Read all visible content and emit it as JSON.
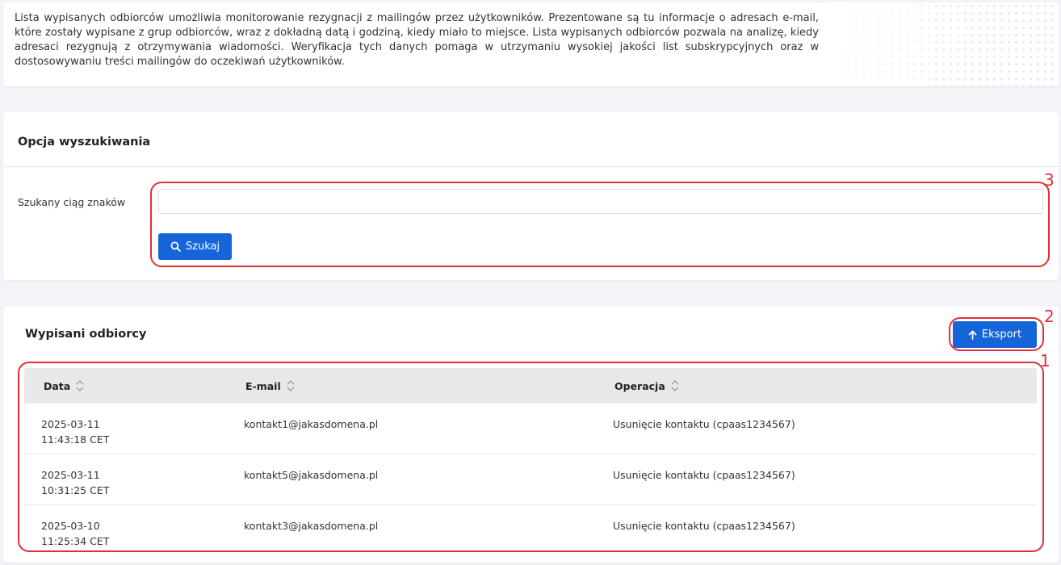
{
  "intro": {
    "text": "Lista wypisanych odbiorców umożliwia monitorowanie rezygnacji z mailingów przez użytkowników. Prezentowane są tu informacje o adresach e-mail, które zostały wypisane z grup odbiorców, wraz z dokładną datą i godziną, kiedy miało to miejsce. Lista wypisanych odbiorców pozwala na analizę, kiedy adresaci rezygnują z otrzymywania wiadomości. Weryfikacja tych danych pomaga w utrzymaniu wysokiej jakości list subskrypcyjnych oraz w dostosowywaniu treści mailingów do oczekiwań użytkowników."
  },
  "search": {
    "title": "Opcja wyszukiwania",
    "field_label": "Szukany ciąg znaków",
    "input_value": "",
    "button_label": "Szukaj"
  },
  "unsubscribed": {
    "title": "Wypisani odbiorcy",
    "export_label": "Eksport",
    "columns": [
      "Data",
      "E-mail",
      "Operacja"
    ],
    "rows": [
      {
        "date": "2025-03-11",
        "time": "11:43:18 CET",
        "email": "kontakt1@jakasdomena.pl",
        "operation": "Usunięcie kontaktu (cpaas1234567)"
      },
      {
        "date": "2025-03-11",
        "time": "10:31:25 CET",
        "email": "kontakt5@jakasdomena.pl",
        "operation": "Usunięcie kontaktu (cpaas1234567)"
      },
      {
        "date": "2025-03-10",
        "time": "11:25:34 CET",
        "email": "kontakt3@jakasdomena.pl",
        "operation": "Usunięcie kontaktu (cpaas1234567)"
      }
    ]
  },
  "annotations": [
    "1",
    "2",
    "3"
  ],
  "colors": {
    "primary": "#1565d8",
    "annotation": "#e02f3a",
    "table_header": "#e7e8ea"
  }
}
